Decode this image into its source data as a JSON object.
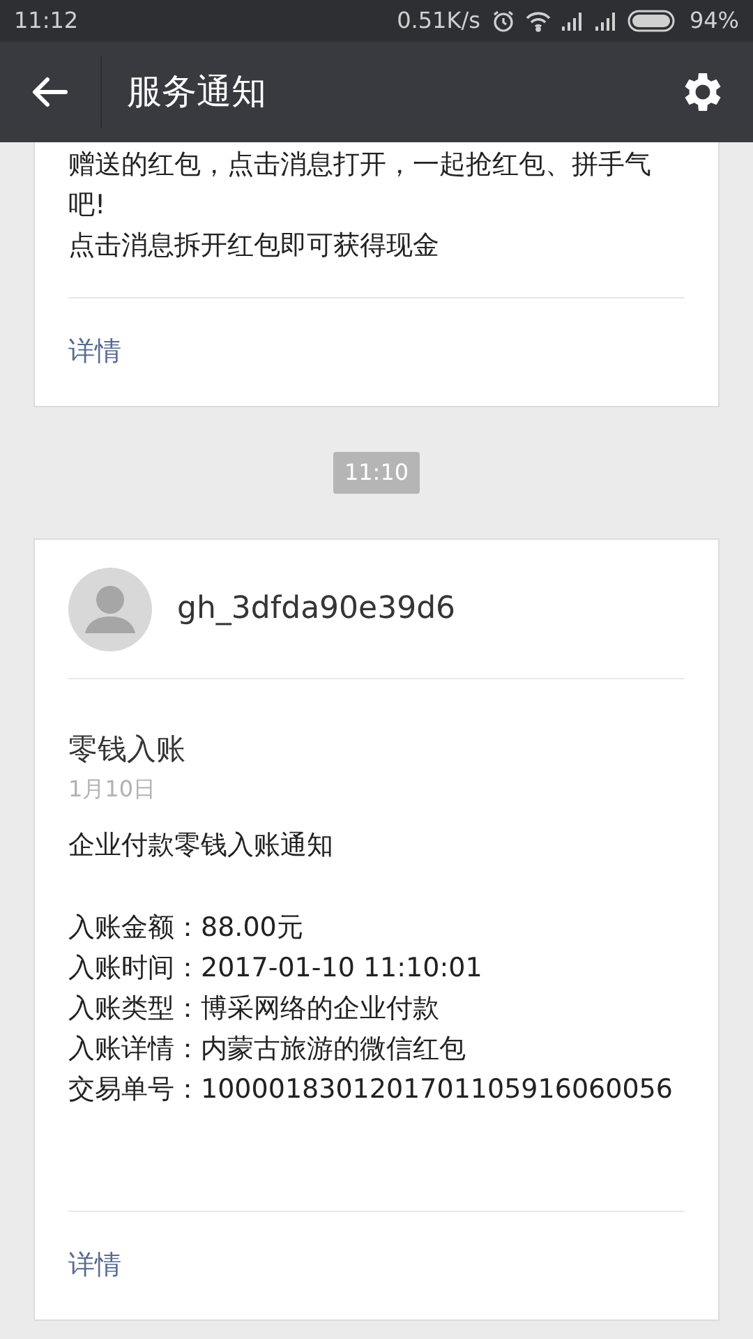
{
  "status_bar": {
    "time": "11:12",
    "speed": "0.51K/s",
    "battery": "94%"
  },
  "header": {
    "title": "服务通知"
  },
  "cards": [
    {
      "lines": [
        "赠送的红包，点击消息打开，一起抢红包、拼手气吧!",
        "点击消息拆开红包即可获得现金"
      ],
      "link": "详情"
    },
    {
      "timestamp": "11:10",
      "sender": "gh_3dfda90e39d6",
      "title": "零钱入账",
      "date": "1月10日",
      "summary": "企业付款零钱入账通知",
      "lines": [
        "入账金额：88.00元",
        "入账时间：2017-01-10 11:10:01",
        "入账类型：博采网络的企业付款",
        "入账详情：内蒙古旅游的微信红包",
        "交易单号：1000018301201701105916060056"
      ],
      "link": "详情"
    }
  ]
}
